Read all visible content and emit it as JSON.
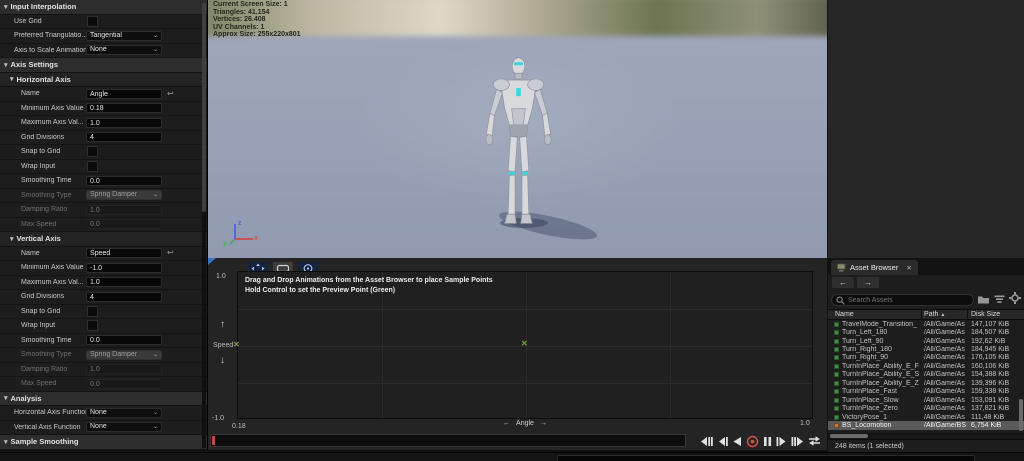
{
  "icons": {
    "caret_down": "▾",
    "chevron_down": "⌄",
    "reset": "↩",
    "arrow_up": "↑",
    "arrow_down": "↓",
    "arrow_left": "←",
    "arrow_right": "→",
    "close": "✕",
    "marker_x": "✕",
    "sort_asc": "▲",
    "nav_back": "←",
    "nav_forward": "→"
  },
  "colors": {
    "accent_blue": "#3a74c2",
    "viewport_bg": "#99a1b4",
    "selection_gray": "#5a5a5a",
    "anim_icon_green": "#3d9142",
    "blendspace_icon_orange": "#c8793c",
    "record_red": "#d9534f",
    "timeline_marker_red": "#bb4b44"
  },
  "details": {
    "headers": {
      "input_interpolation": "Input Interpolation",
      "axis_settings": "Axis Settings",
      "analysis": "Analysis",
      "sample_smoothing": "Sample Smoothing"
    },
    "input_interpolation": {
      "use_grid_label": "Use Grid",
      "preferred_triangulation_label": "Preferred Triangulatio...",
      "preferred_triangulation_value": "Tangential",
      "axis_to_scale_label": "Axis to Scale Animation",
      "axis_to_scale_value": "None"
    },
    "horizontal_axis": {
      "title": "Horizontal Axis",
      "name_label": "Name",
      "name_value": "Angle",
      "min_label": "Minimum Axis Value",
      "min_value": "0.18",
      "max_label": "Maximum Axis Val...",
      "max_value": "1.0",
      "grid_divisions_label": "Grid Divisions",
      "grid_divisions_value": "4",
      "snap_label": "Snap to Grid",
      "wrap_label": "Wrap Input",
      "smoothing_time_label": "Smoothing Time",
      "smoothing_time_value": "0.0",
      "smoothing_type_label": "Smoothing Type",
      "smoothing_type_value": "Spring Damper",
      "damping_label": "Damping Ratio",
      "damping_value": "1.0",
      "max_speed_label": "Max Speed",
      "max_speed_value": "0.0"
    },
    "vertical_axis": {
      "title": "Vertical Axis",
      "name_label": "Name",
      "name_value": "Speed",
      "min_label": "Minimum Axis Value",
      "min_value": "-1.0",
      "max_label": "Maximum Axis Val...",
      "max_value": "1.0",
      "grid_divisions_label": "Grid Divisions",
      "grid_divisions_value": "4",
      "snap_label": "Snap to Grid",
      "wrap_label": "Wrap Input",
      "smoothing_time_label": "Smoothing Time",
      "smoothing_time_value": "0.0",
      "smoothing_type_label": "Smoothing Type",
      "smoothing_type_value": "Spring Damper",
      "damping_label": "Damping Ratio",
      "damping_value": "1.0",
      "max_speed_label": "Max Speed",
      "max_speed_value": "0.0"
    },
    "analysis": {
      "horizontal_label": "Horizontal Axis Function",
      "horizontal_value": "None",
      "vertical_label": "Vertical Axis Function",
      "vertical_value": "None"
    }
  },
  "viewport": {
    "stats": {
      "line1": "Current Screen Size: 1",
      "line2": "Triangles: 41.154",
      "line3": "Vertices: 26.408",
      "line4": "UV Channels: 1",
      "line5": "Approx Size: 255x220x801"
    },
    "gizmo": {
      "x": "x",
      "y": "y",
      "z": "z"
    }
  },
  "graph": {
    "hint_line1": "Drag and Drop Animations from the Asset Browser to place Sample Points",
    "hint_line2": "Hold Control to set the Preview Point (Green)",
    "y_axis_label": "Speed",
    "y_max": "1.0",
    "y_min": "-1.0",
    "x_axis_label": "Angle",
    "x_min": "0.18",
    "x_max": "1.0"
  },
  "asset_browser": {
    "tab_title": "Asset Browser",
    "search_placeholder": "Search Assets",
    "columns": {
      "name": "Name",
      "path": "Path",
      "disk_size": "Disk Size"
    },
    "rows": [
      {
        "name": "TravelMode_Transition_",
        "path": "/All/Game/As",
        "size": "147,107 KiB"
      },
      {
        "name": "Turn_Left_180",
        "path": "/All/Game/As",
        "size": "184,507 KiB"
      },
      {
        "name": "Turn_Left_90",
        "path": "/All/Game/As",
        "size": "192,62 KiB"
      },
      {
        "name": "Turn_Right_180",
        "path": "/All/Game/As",
        "size": "184,945 KiB"
      },
      {
        "name": "Turn_Right_90",
        "path": "/All/Game/As",
        "size": "176,105 KiB"
      },
      {
        "name": "TurnInPlace_Ability_E_F",
        "path": "/All/Game/As",
        "size": "160,106 KiB"
      },
      {
        "name": "TurnInPlace_Ability_E_S",
        "path": "/All/Game/As",
        "size": "154,388 KiB"
      },
      {
        "name": "TurnInPlace_Ability_E_Z",
        "path": "/All/Game/As",
        "size": "139,396 KiB"
      },
      {
        "name": "TurnInPlace_Fast",
        "path": "/All/Game/As",
        "size": "159,338 KiB"
      },
      {
        "name": "TurnInPlace_Slow",
        "path": "/All/Game/As",
        "size": "153,091 KiB"
      },
      {
        "name": "TurnInPlace_Zero",
        "path": "/All/Game/As",
        "size": "137,821 KiB"
      },
      {
        "name": "VictoryPose_1",
        "path": "/All/Game/As",
        "size": "111,48 KiB"
      },
      {
        "name": "BS_Locomotion",
        "path": "/All/Game/BS",
        "size": "6,754 KiB"
      }
    ],
    "status": "248 items (1 selected)"
  }
}
